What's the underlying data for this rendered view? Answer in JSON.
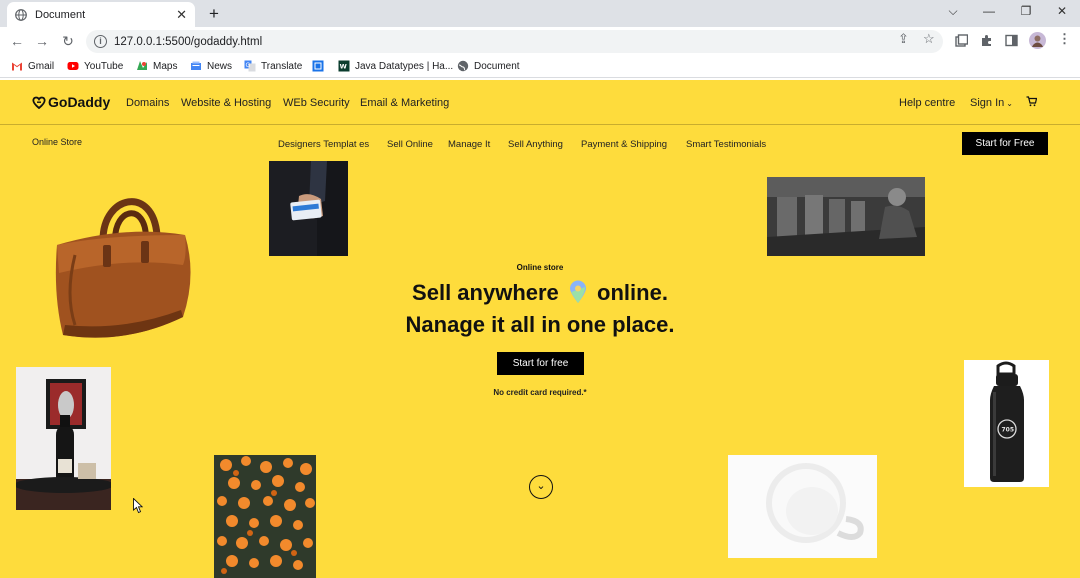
{
  "browser": {
    "tab_title": "Document",
    "tab_close": "✕",
    "new_tab": "+",
    "url": "127.0.0.1:5500/godaddy.html",
    "bookmarks": [
      {
        "label": "Gmail",
        "icon": "gmail-icon",
        "color": "#ea4335"
      },
      {
        "label": "YouTube",
        "icon": "youtube-icon",
        "color": "#ff0000"
      },
      {
        "label": "Maps",
        "icon": "maps-icon",
        "color": "#34a853"
      },
      {
        "label": "News",
        "icon": "news-icon",
        "color": "#4285f4"
      },
      {
        "label": "Translate",
        "icon": "translate-icon",
        "color": "#4285f4"
      },
      {
        "label": "",
        "icon": "bookmark-page-icon",
        "color": "#1a73e8"
      },
      {
        "label": "Java Datatypes | Ha...",
        "icon": "java-icon",
        "color": "#0b3d2e"
      },
      {
        "label": "Document",
        "icon": "globe-icon",
        "color": "#5f6368"
      }
    ]
  },
  "site": {
    "logo": "GoDaddy",
    "nav": [
      "Domains",
      "Website & Hosting",
      "WEb Security",
      "Email & Marketing"
    ],
    "help": "Help centre",
    "signin": "Sign In",
    "subnav_title": "Online Store",
    "subnav": [
      "Designers Templat es",
      "Sell Online",
      "Manage It",
      "Sell Anything",
      "Payment & Shipping",
      "Smart Testimonials"
    ],
    "cta_top": "Start for Free",
    "hero": {
      "eyebrow": "Online store",
      "line1_a": "Sell anywhere",
      "line1_b": "online.",
      "line2": "Nanage it all in one place.",
      "cta": "Start for free",
      "note": "No credit card required.*"
    },
    "colors": {
      "brand_yellow": "#fedc3c",
      "black": "#000000"
    }
  }
}
